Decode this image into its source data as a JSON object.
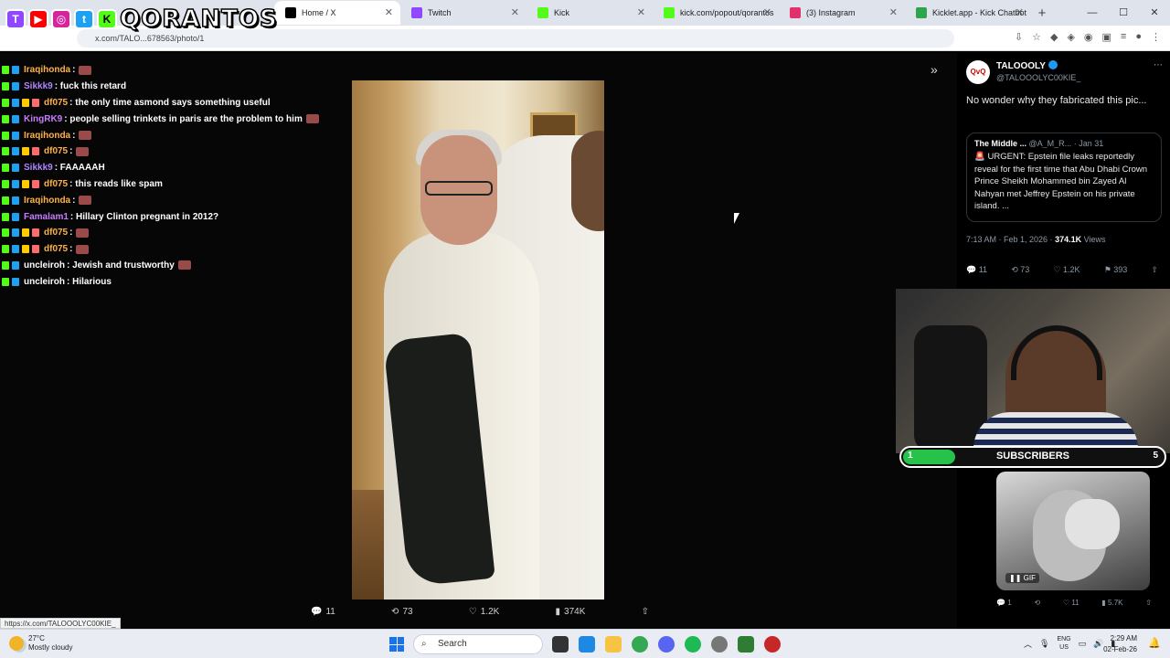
{
  "browser": {
    "tabs": [
      {
        "title": "Home / X",
        "color": "#000000",
        "active": true
      },
      {
        "title": "Twitch",
        "color": "#9146ff",
        "active": false
      },
      {
        "title": "Kick",
        "color": "#53fc18",
        "active": false
      },
      {
        "title": "kick.com/popout/qorantos",
        "color": "#53fc18",
        "active": false
      },
      {
        "title": "(3) Instagram",
        "color": "#e1306c",
        "active": false
      },
      {
        "title": "Kicklet.app - Kick Chatbot",
        "color": "#2ea44f",
        "active": false
      }
    ],
    "url": "x.com/TALO...678563/photo/1",
    "status_url": "https://x.com/TALOOOLYC00KIE_"
  },
  "overlay": {
    "brand": "QORANTOS",
    "social_icons": [
      "twitch-icon",
      "youtube-icon",
      "instagram-icon",
      "twitter-icon",
      "kick-icon"
    ]
  },
  "chat": {
    "messages": [
      {
        "user": "Iraqihonda",
        "color": "#ffb347",
        "text": ":",
        "emote": true
      },
      {
        "user": "Sikkk9",
        "color": "#b085ff",
        "text": ": fuck this retard",
        "emote": false
      },
      {
        "user": "df075",
        "color": "#ffb347",
        "text": ": the only time asmond says something useful",
        "emote": false
      },
      {
        "user": "KingRK9",
        "color": "#c77dff",
        "text": ": people selling trinkets in paris are the problem to him",
        "emote": true
      },
      {
        "user": "Iraqihonda",
        "color": "#ffb347",
        "text": ":",
        "emote": true
      },
      {
        "user": "df075",
        "color": "#ffb347",
        "text": ":",
        "emote": true
      },
      {
        "user": "Sikkk9",
        "color": "#b085ff",
        "text": ": FAAAAAH",
        "emote": false
      },
      {
        "user": "df075",
        "color": "#ffb347",
        "text": ": this reads like spam",
        "emote": false
      },
      {
        "user": "Iraqihonda",
        "color": "#ffb347",
        "text": ":",
        "emote": true
      },
      {
        "user": "Famalam1",
        "color": "#c77dff",
        "text": ": Hillary Clinton pregnant in 2012?",
        "emote": false
      },
      {
        "user": "df075",
        "color": "#ffb347",
        "text": ":",
        "emote": true
      },
      {
        "user": "df075",
        "color": "#ffb347",
        "text": ":",
        "emote": true
      },
      {
        "user": "uncleiroh",
        "color": "#ffffff",
        "text": ": Jewish and trustworthy",
        "emote": true
      },
      {
        "user": "uncleiroh",
        "color": "#ffffff",
        "text": ": Hilarious",
        "emote": false
      }
    ]
  },
  "photo_stats": {
    "replies": "11",
    "reposts": "73",
    "likes": "1.2K",
    "views": "374K"
  },
  "tweet": {
    "display_name": "TALOOOLY",
    "handle": "@TALOOOLYC00KIE_",
    "text": "No wonder why they fabricated this pic...",
    "quote": {
      "author": "The Middle ...",
      "handle": "@A_M_R...",
      "date": "Jan 31",
      "text": "🚨 URGENT: Epstein file leaks reportedly reveal for the first time that Abu Dhabi Crown Prince Sheikh Mohammed bin Zayed Al Nahyan met Jeffrey Epstein on his private island. ..."
    },
    "time": "7:13 AM · Feb 1, 2026 ·",
    "views_count": "374.1K",
    "views_label": "Views",
    "replies": "11",
    "reposts": "73",
    "likes": "1.2K",
    "bookmarks": "393"
  },
  "subs_widget": {
    "label": "SUBSCRIBERS",
    "current": "1",
    "goal": "5",
    "progress": 0.2,
    "color": "#26c24a"
  },
  "gif": {
    "badge": "GIF",
    "replies": "1",
    "likes": "11",
    "views": "5.7K"
  },
  "taskbar": {
    "temp": "27°C",
    "weather": "Mostly cloudy",
    "search_placeholder": "Search",
    "lang_top": "ENG",
    "lang_bottom": "US",
    "time": "2:29 AM",
    "date": "02-Feb-26"
  }
}
